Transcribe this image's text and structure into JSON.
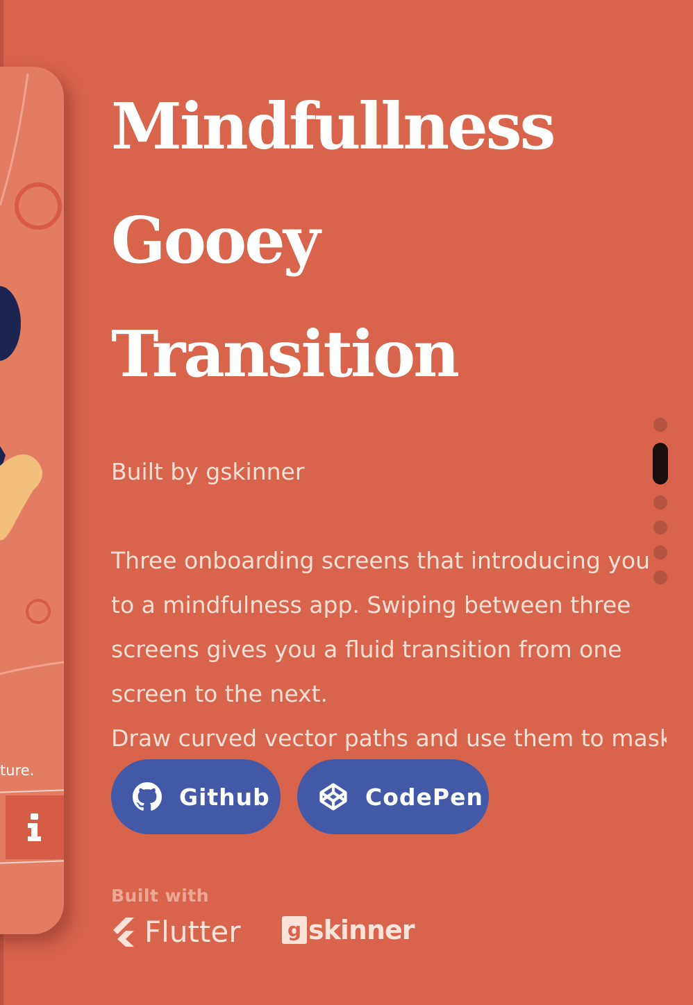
{
  "page": {
    "background": "#d8644c",
    "accent_button": "#4359a8"
  },
  "phone_preview": {
    "caption": "ture.",
    "info_icon": "info-icon"
  },
  "title": {
    "line1": "Mindfullness",
    "line2": "Gooey",
    "line3": "Transition"
  },
  "byline": "Built by gskinner",
  "description": {
    "lines": [
      "Three onboarding screens that introducing you",
      "to a mindfulness app. Swiping between three",
      "screens gives you a fluid transition from one",
      "screen to the next.",
      "Draw curved vector paths and use them to mask"
    ]
  },
  "pagination": {
    "count": 6,
    "active_index": 1
  },
  "buttons": {
    "github": {
      "label": "Github",
      "icon": "github-icon"
    },
    "codepen": {
      "label": "CodePen",
      "icon": "codepen-icon"
    }
  },
  "footer": {
    "built_with": "Built with",
    "flutter": "Flutter",
    "gskinner": "skinner",
    "gskinner_mark": "g"
  }
}
